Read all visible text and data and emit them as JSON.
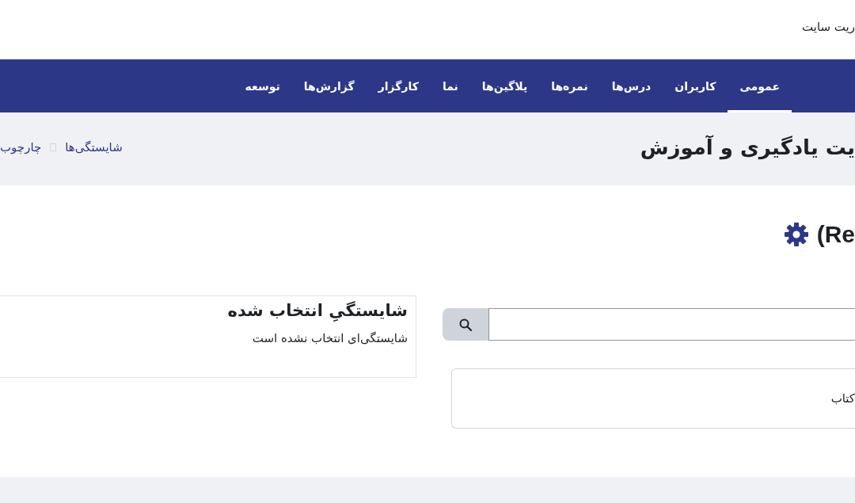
{
  "header": {
    "site_admin_label": "ریت سایت"
  },
  "nav": {
    "tabs": [
      {
        "label": "عمومی",
        "selected": true
      },
      {
        "label": "کاربران",
        "selected": false
      },
      {
        "label": "درس‌ها",
        "selected": false
      },
      {
        "label": "نمره‌ها",
        "selected": false
      },
      {
        "label": "پلاگین‌ها",
        "selected": false
      },
      {
        "label": "نما",
        "selected": false
      },
      {
        "label": "کارگزار",
        "selected": false
      },
      {
        "label": "گزارش‌ها",
        "selected": false
      },
      {
        "label": "توسعه",
        "selected": false
      }
    ]
  },
  "page_header": {
    "title": "یت یادگیری و آموزش",
    "breadcrumb": [
      "شایستگی‌ها",
      "چارچوب"
    ]
  },
  "heading": {
    "text": "(Re"
  },
  "framework_list": {
    "items": [
      "کتاب"
    ]
  },
  "selected_panel": {
    "title": "شایستگیِ انتخاب شده",
    "message": "شایستگی‌ای انتخاب نشده است"
  }
}
